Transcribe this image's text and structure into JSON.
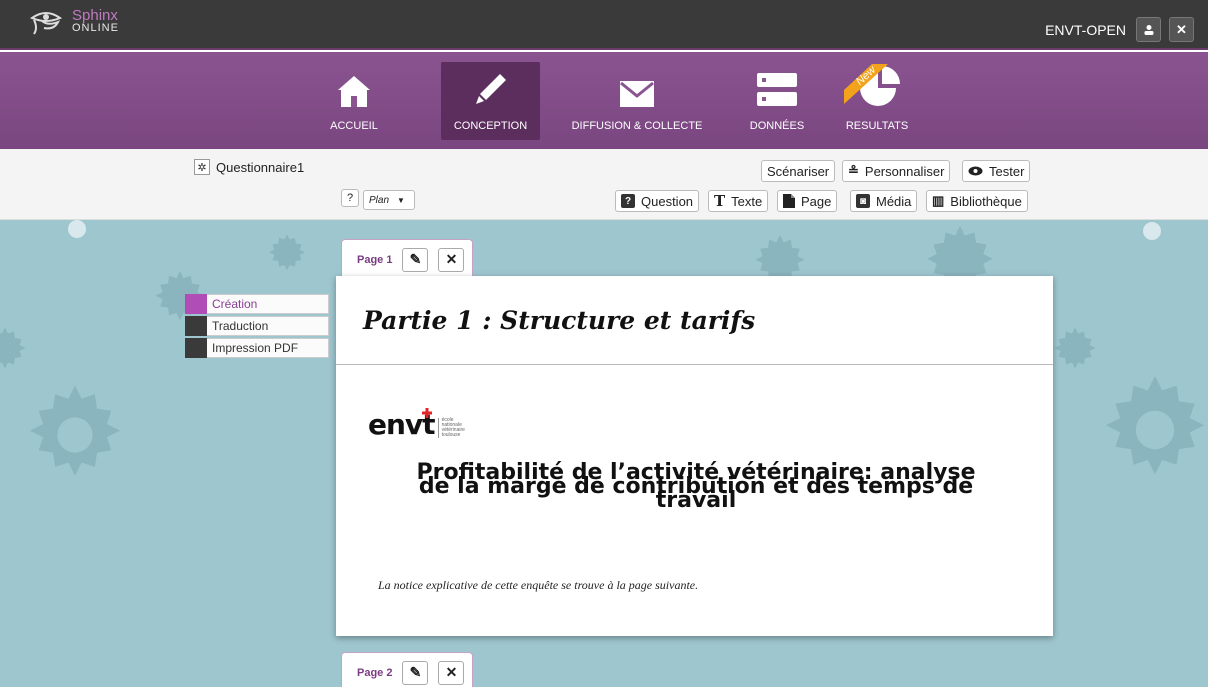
{
  "app": {
    "logo_line1": "Sphinx",
    "logo_line2": "ONLINE",
    "user": "ENVT-OPEN"
  },
  "nav": {
    "items": [
      {
        "label": "ACCUEIL",
        "icon": "home-icon"
      },
      {
        "label": "CONCEPTION",
        "icon": "pencil-icon",
        "active": true
      },
      {
        "label": "DIFFUSION & COLLECTE",
        "icon": "envelope-icon"
      },
      {
        "label": "DONNÉES",
        "icon": "database-icon"
      },
      {
        "label": "RESULTATS",
        "icon": "pie-chart-icon",
        "badge": "New"
      }
    ]
  },
  "toolbar": {
    "questionnaire_name": "Questionnaire1",
    "help": "?",
    "view_select": "Plan",
    "scenariser": "Scénariser",
    "personnaliser": "Personnaliser",
    "tester": "Tester",
    "question": "Question",
    "texte": "Texte",
    "page": "Page",
    "media": "Média",
    "bibliotheque": "Bibliothèque"
  },
  "languages": [
    {
      "label": "Création",
      "color": "#b04db6",
      "selected": true
    },
    {
      "label": "Traduction",
      "color": "#3a3a3a"
    },
    {
      "label": "Impression PDF",
      "color": "#3a3a3a"
    }
  ],
  "pages": [
    {
      "label": "Page 1",
      "title": "Partie 1 : Structure et tarifs",
      "logo_text": "envt",
      "logo_sub": [
        "école",
        "nationale",
        "vétérinaire",
        "toulouse"
      ],
      "heading_line1": "Profitabilité de l’activité vétérinaire: analyse",
      "heading_line2": "de la marge de contribution et des temps de",
      "heading_line3": "travail",
      "note": "La notice explicative de cette enquête se trouve à la page suivante."
    },
    {
      "label": "Page 2"
    }
  ],
  "colors": {
    "topbar": "#3a3a3a",
    "nav": "#8a5490",
    "nav_active": "#5b2e5e",
    "canvas": "#9ec6cf",
    "badge": "#f2a21b"
  }
}
